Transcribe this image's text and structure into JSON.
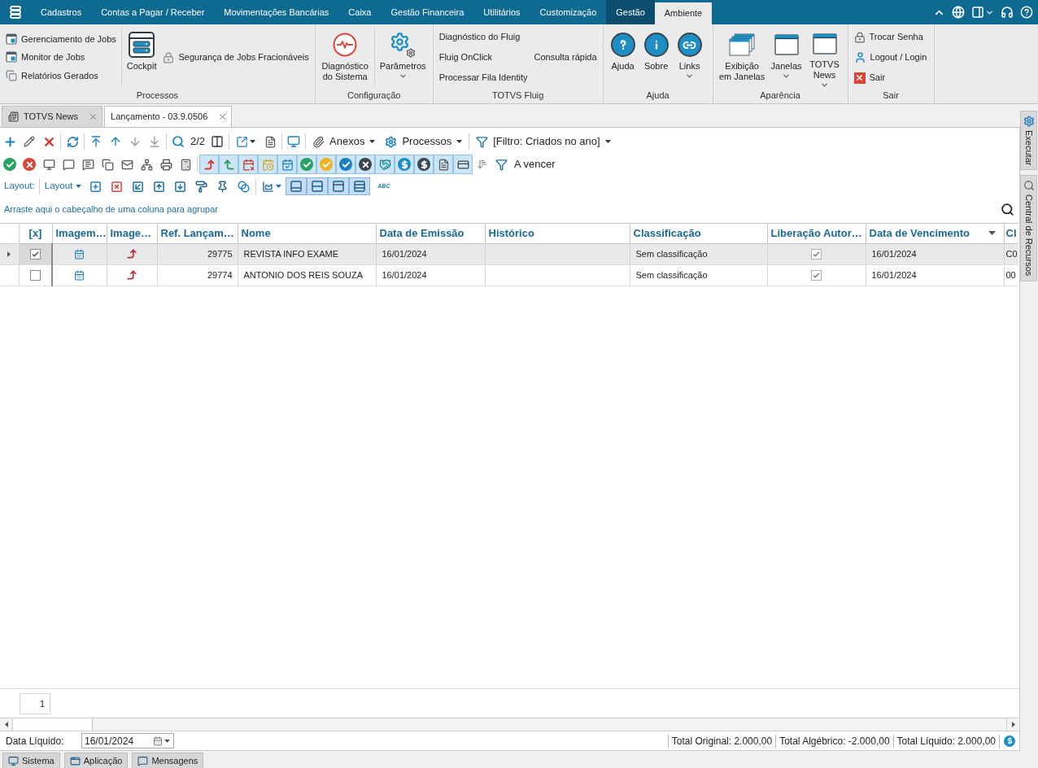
{
  "menu_bar": {
    "tabs": [
      {
        "label": "Cadastros",
        "selected": false,
        "hovered": false
      },
      {
        "label": "Contas a Pagar / Receber",
        "selected": false,
        "hovered": false
      },
      {
        "label": "Movimentações Bancárias",
        "selected": false,
        "hovered": false
      },
      {
        "label": "Caixa",
        "selected": false,
        "hovered": false
      },
      {
        "label": "Gestão Financeira",
        "selected": false,
        "hovered": false
      },
      {
        "label": "Utilitários",
        "selected": false,
        "hovered": false
      },
      {
        "label": "Customização",
        "selected": false,
        "hovered": false
      },
      {
        "label": "Gestão",
        "selected": false,
        "hovered": true
      },
      {
        "label": "Ambiente",
        "selected": true,
        "hovered": false
      }
    ]
  },
  "ribbon": {
    "groups": [
      {
        "label": "Processos",
        "columns": [
          {
            "kind": "stack",
            "items": [
              {
                "label": "Gerenciamento de Jobs"
              },
              {
                "label": "Monitor de Jobs"
              },
              {
                "label": "Relatórios Gerados"
              }
            ]
          },
          {
            "kind": "large",
            "items": [
              {
                "label": "Cockpit",
                "dropdown": false
              }
            ]
          },
          {
            "kind": "stack",
            "items": [
              {
                "label": "Segurança de Jobs Fracionáveis"
              }
            ]
          }
        ]
      },
      {
        "label": "Configuração",
        "columns": [
          {
            "kind": "large",
            "items": [
              {
                "label": "Diagnóstico do Sistema",
                "dropdown": false
              }
            ]
          },
          {
            "kind": "large",
            "items": [
              {
                "label": "Parâmetros",
                "dropdown": true
              }
            ]
          }
        ]
      },
      {
        "label": "TOTVS Fluig",
        "columns": [
          {
            "kind": "stack",
            "items": [
              {
                "label": "Diagnóstico do Fluig"
              },
              {
                "label": "Fluig OnClick"
              },
              {
                "label": "Processar Fila Identity"
              }
            ]
          },
          {
            "kind": "stack",
            "items": [
              {
                "label": "Consulta rápida"
              }
            ]
          }
        ]
      },
      {
        "label": "Ajuda",
        "columns": [
          {
            "kind": "large",
            "items": [
              {
                "label": "Ajuda",
                "dropdown": false
              },
              {
                "label": "Sobre",
                "dropdown": false
              },
              {
                "label": "Links",
                "dropdown": true
              }
            ]
          }
        ]
      },
      {
        "label": "Aparência",
        "columns": [
          {
            "kind": "large",
            "items": [
              {
                "label": "Exibição em Janelas",
                "dropdown": false
              },
              {
                "label": "Janelas",
                "dropdown": true
              },
              {
                "label": "TOTVS News",
                "dropdown": true
              }
            ]
          }
        ]
      },
      {
        "label": "Sair",
        "columns": [
          {
            "kind": "stack",
            "items": [
              {
                "label": "Trocar Senha"
              },
              {
                "label": "Logout / Login"
              },
              {
                "label": "Sair"
              }
            ]
          }
        ]
      }
    ]
  },
  "document_tabs": [
    {
      "label": "TOTVS News",
      "selected": false
    },
    {
      "label": "Lançamento - 03.9.0506",
      "selected": true
    }
  ],
  "toolbar": {
    "counter": "2/2",
    "menus": [
      {
        "label": "Anexos"
      },
      {
        "label": "Processos"
      },
      {
        "label": "[Filtro: Criados no ano]"
      }
    ]
  },
  "filter_bar": {
    "toggles": [
      {
        "on": true
      },
      {
        "on": true
      },
      {
        "on": true
      },
      {
        "on": true
      },
      {
        "on": true
      },
      {
        "on": true
      },
      {
        "on": true
      },
      {
        "on": true
      },
      {
        "on": true
      },
      {
        "on": true
      },
      {
        "on": true
      },
      {
        "on": true
      },
      {
        "on": true
      },
      {
        "on": true
      }
    ],
    "filter_label": "A vencer"
  },
  "layout_bar": {
    "label": "Layout:",
    "menu": "Layout",
    "view_toggles": [
      {
        "on": true
      },
      {
        "on": true
      },
      {
        "on": true
      },
      {
        "on": true
      }
    ],
    "abc_label": "ABC"
  },
  "group_panel": {
    "hint": "Arraste aqui o cabeçalho de uma coluna para agrupar"
  },
  "table": {
    "columns": [
      {
        "label": "[x]",
        "sort_descending": false
      },
      {
        "label": "Imagem…",
        "sort_descending": false
      },
      {
        "label": "Image…",
        "sort_descending": false
      },
      {
        "label": "Ref. Lançam…",
        "sort_descending": false
      },
      {
        "label": "Nome",
        "sort_descending": false
      },
      {
        "label": "Data de Emissão",
        "sort_descending": false
      },
      {
        "label": "Histórico",
        "sort_descending": false
      },
      {
        "label": "Classificação",
        "sort_descending": false
      },
      {
        "label": "Liberação Autor…",
        "sort_descending": false
      },
      {
        "label": "Data de Vencimento",
        "sort_descending": true
      },
      {
        "label": "Cl",
        "sort_descending": false
      }
    ],
    "rows": [
      {
        "selected": true,
        "checked": true,
        "ref": "29775",
        "name": "REVISTA INFO EXAME",
        "issue_date": "16/01/2024",
        "classification": "Sem classificação",
        "released": true,
        "due_date": "16/01/2024",
        "column_11": "C0"
      },
      {
        "selected": false,
        "checked": false,
        "ref": "29774",
        "name": "ANTONIO DOS REIS SOUZA",
        "issue_date": "16/01/2024",
        "classification": "Sem classificação",
        "released": true,
        "due_date": "16/01/2024",
        "column_11": "00"
      }
    ]
  },
  "pager": {
    "page": "1"
  },
  "status": {
    "date_label": "Data Líquido:",
    "date_value": "16/01/2024",
    "totals": [
      {
        "label": "Total Original: 2.000,00"
      },
      {
        "label": "Total Algébrico: -2.000,00"
      },
      {
        "label": "Total Líquido: 2.000,00"
      }
    ]
  },
  "side_panel": {
    "tabs": [
      {
        "label": "Executar"
      },
      {
        "label": "Central de Recursos"
      }
    ]
  },
  "bottom_tabs": [
    {
      "label": "Sistema"
    },
    {
      "label": "Aplicação"
    },
    {
      "label": "Mensagens"
    }
  ]
}
